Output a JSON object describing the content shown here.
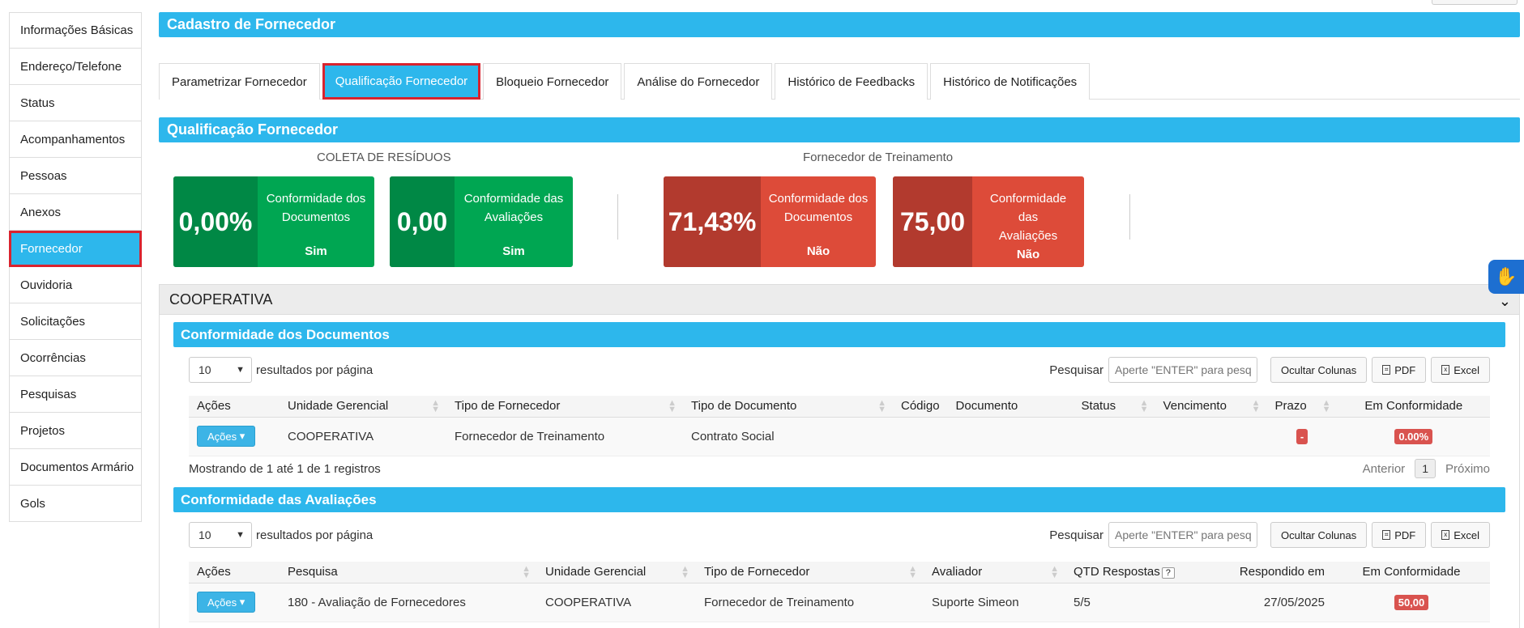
{
  "sidebar": {
    "items": [
      {
        "label": "Informações Básicas"
      },
      {
        "label": "Endereço/Telefone"
      },
      {
        "label": "Status"
      },
      {
        "label": "Acompanhamentos"
      },
      {
        "label": "Pessoas"
      },
      {
        "label": "Anexos"
      },
      {
        "label": "Fornecedor"
      },
      {
        "label": "Ouvidoria"
      },
      {
        "label": "Solicitações"
      },
      {
        "label": "Ocorrências"
      },
      {
        "label": "Pesquisas"
      },
      {
        "label": "Projetos"
      },
      {
        "label": "Documentos Armário"
      },
      {
        "label": "Gols"
      }
    ]
  },
  "header": {
    "title": "Cadastro de Fornecedor"
  },
  "tabs": [
    {
      "label": "Parametrizar Fornecedor"
    },
    {
      "label": "Qualificação Fornecedor"
    },
    {
      "label": "Bloqueio Fornecedor"
    },
    {
      "label": "Análise do Fornecedor"
    },
    {
      "label": "Histórico de Feedbacks"
    },
    {
      "label": "Histórico de Notificações"
    }
  ],
  "qualificacao": {
    "title": "Qualificação Fornecedor",
    "groups": [
      {
        "label": "COLETA DE RESÍDUOS"
      },
      {
        "label": "Fornecedor de Treinamento"
      }
    ],
    "kpis": [
      {
        "value": "0,00%",
        "line1": "Conformidade dos",
        "line2": "Documentos",
        "result": "Sim",
        "color": "#00a652"
      },
      {
        "value": "0,00",
        "line1": "Conformidade das",
        "line2": "Avaliações",
        "result": "Sim",
        "color": "#00a652"
      },
      {
        "value": "71,43%",
        "line1": "Conformidade dos",
        "line2": "Documentos",
        "result": "Não",
        "color": "#dd4b39"
      },
      {
        "value": "75,00",
        "line1": "Conformidade das",
        "line2": "Avaliações",
        "result": "Não",
        "color": "#dd4b39"
      }
    ]
  },
  "cooperativa": {
    "title": "COOPERATIVA",
    "docs": {
      "title": "Conformidade dos Documentos",
      "page_size": "10",
      "rpp_label": "resultados por página",
      "search_label": "Pesquisar",
      "search_placeholder": "Aperte \"ENTER\" para pesquisar",
      "btn_cols": "Ocultar Colunas",
      "btn_pdf": "PDF",
      "btn_excel": "Excel",
      "columns": [
        "Ações",
        "Unidade Gerencial",
        "Tipo de Fornecedor",
        "Tipo de Documento",
        "Código",
        "Documento",
        "Status",
        "Vencimento",
        "Prazo",
        "Em Conformidade"
      ],
      "row": {
        "acoes": "Ações",
        "unidade": "COOPERATIVA",
        "tipo_fornecedor": "Fornecedor de Treinamento",
        "tipo_documento": "Contrato Social",
        "codigo": "",
        "documento": "",
        "status": "",
        "vencimento": "",
        "prazo": "-",
        "conformidade": "0.00%"
      },
      "footer_text": "Mostrando de 1 até 1 de 1 registros",
      "prev": "Anterior",
      "page": "1",
      "next": "Próximo"
    },
    "avals": {
      "title": "Conformidade das Avaliações",
      "page_size": "10",
      "rpp_label": "resultados por página",
      "search_label": "Pesquisar",
      "search_placeholder": "Aperte \"ENTER\" para pesquisar",
      "btn_cols": "Ocultar Colunas",
      "btn_pdf": "PDF",
      "btn_excel": "Excel",
      "columns": [
        "Ações",
        "Pesquisa",
        "Unidade Gerencial",
        "Tipo de Fornecedor",
        "Avaliador",
        "QTD Respostas",
        "Respondido em",
        "Em Conformidade"
      ],
      "qtd_help": "?",
      "row": {
        "acoes": "Ações",
        "pesquisa": "180 - Avaliação de Fornecedores",
        "unidade": "COOPERATIVA",
        "tipo_fornecedor": "Fornecedor de Treinamento",
        "avaliador": "Suporte Simeon",
        "qtd": "5/5",
        "respondido": "27/05/2025",
        "conformidade": "50,00"
      }
    }
  }
}
